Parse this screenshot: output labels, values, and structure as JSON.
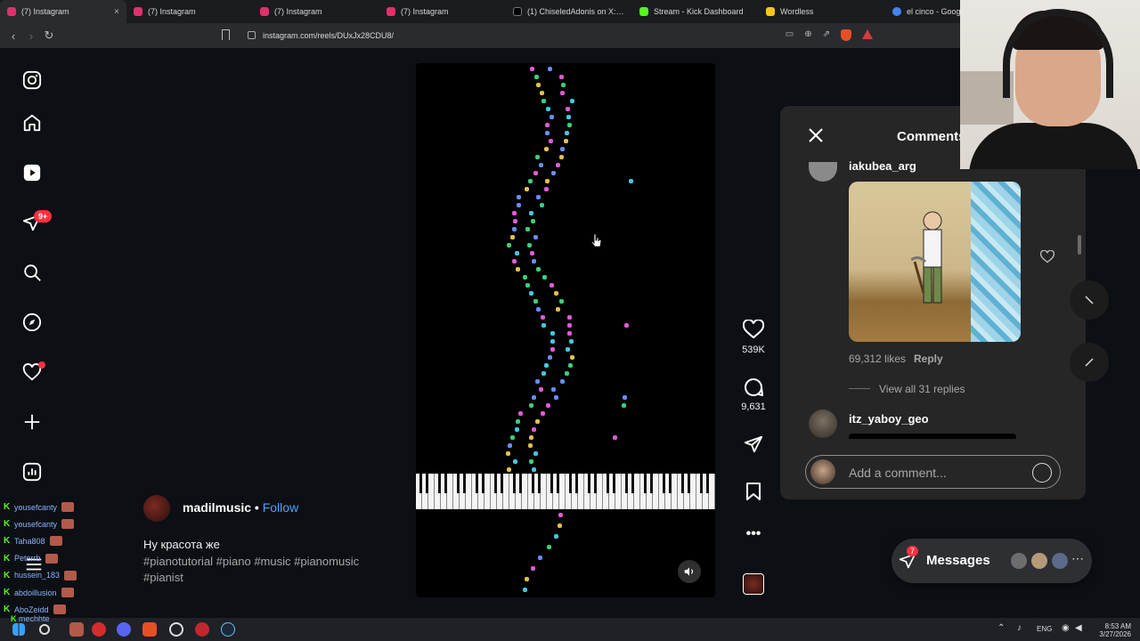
{
  "browser": {
    "tabs": [
      {
        "label": "(7) Instagram",
        "color": "#e1306c",
        "active": true
      },
      {
        "label": "(7) Instagram",
        "color": "#e1306c",
        "active": false
      },
      {
        "label": "(7) Instagram",
        "color": "#e1306c",
        "active": false
      },
      {
        "label": "(7) Instagram",
        "color": "#e1306c",
        "active": false
      },
      {
        "label": "(1) ChiseledAdonis on X: \"Wha",
        "color": "#000000",
        "active": false
      },
      {
        "label": "Stream - Kick Dashboard",
        "color": "#53fc18",
        "active": false
      },
      {
        "label": "Wordless",
        "color": "#f5c518",
        "active": false
      },
      {
        "label": "el cinco - Googl",
        "color": "#4285f4",
        "active": false
      }
    ],
    "tab_close": "×",
    "url": "instagram.com/reels/DUxJx28CDU8/"
  },
  "sidebar": {
    "notification_badge": "9+"
  },
  "reel": {
    "username": "madilmusic",
    "separator": " • ",
    "follow_label": "Follow",
    "caption": "Ну красота же",
    "hashtags": "#pianotutorial #piano #music #pianomusic #pianist",
    "likes": "539K",
    "comments_count": "9,631"
  },
  "comments_panel": {
    "title": "Comments",
    "comment1": {
      "user": "iakubea_arg",
      "likes": "69,312 likes",
      "reply": "Reply",
      "view_replies": "View all 31 replies"
    },
    "comment2": {
      "user": "itz_yaboy_geo"
    },
    "add_comment_placeholder": "Add a comment..."
  },
  "messages": {
    "label": "Messages",
    "badge": "7",
    "more": "⋯"
  },
  "chat": {
    "lines": [
      "yousefcanty",
      "yousefcanty",
      "Taha808",
      "Peterrb",
      "hussein_183",
      "abdoillusion",
      "AboZeidd",
      "mechhte"
    ]
  },
  "taskbar": {
    "lang": "ENG",
    "time": "8:53 AM",
    "date": "3/27/2026"
  },
  "colors": {
    "accent_link": "#4aa3ff",
    "notification_red": "#ff3040",
    "kick_green": "#53fc18"
  }
}
